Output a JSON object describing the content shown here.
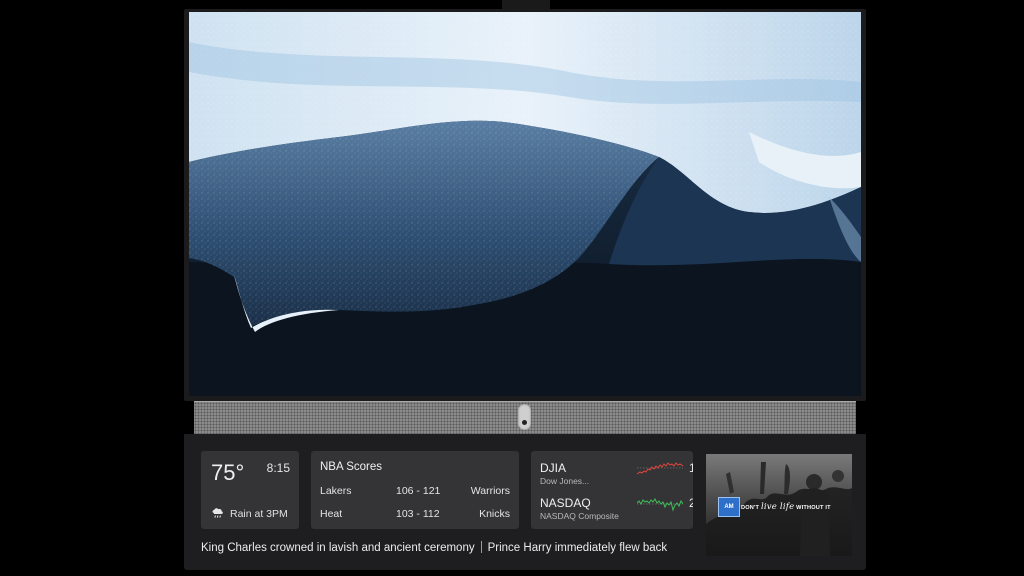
{
  "weather": {
    "temperature": "75°",
    "time": "8:15",
    "forecast": "Rain at 3PM",
    "icon": "rain-cloud-icon"
  },
  "nba": {
    "title": "NBA Scores",
    "games": [
      {
        "home": "Lakers",
        "score": "106 - 121",
        "away": "Warriors"
      },
      {
        "home": "Heat",
        "score": "103 - 112",
        "away": "Knicks"
      }
    ]
  },
  "stocks": {
    "items": [
      {
        "symbol": "DJIA",
        "name": "Dow Jones...",
        "trend_color": "#e0453c",
        "clipped_value": "1"
      },
      {
        "symbol": "NASDAQ",
        "name": "NASDAQ Composite",
        "trend_color": "#3fbf57",
        "clipped_value": "2"
      }
    ]
  },
  "ticker": {
    "headlines": [
      "King Charles crowned in lavish and ancient ceremony",
      "Prince Harry immediately flew back"
    ]
  },
  "ad": {
    "logo_text": "AM",
    "tagline_1": "DON'T",
    "tagline_2": "live life",
    "tagline_3": "WITHOUT IT"
  },
  "colors": {
    "panel": "#1e1e20",
    "card": "#343436"
  }
}
